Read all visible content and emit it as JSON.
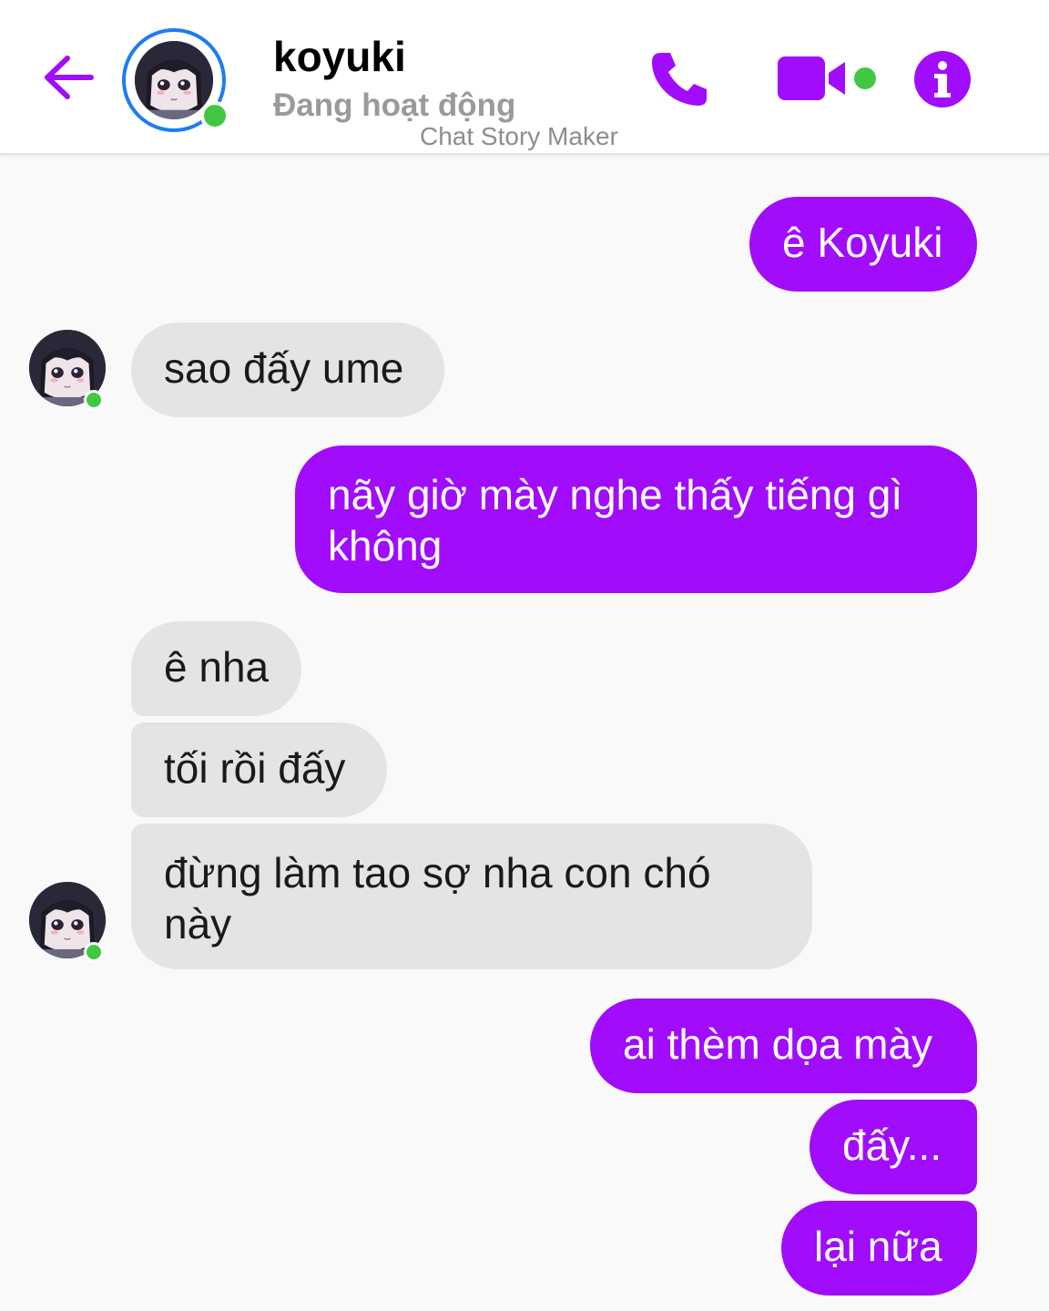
{
  "header": {
    "contact_name": "koyuki",
    "status": "Đang hoạt động",
    "watermark": "Chat Story Maker",
    "back_icon": "arrow-left-icon",
    "call_icon": "phone-icon",
    "video_icon": "video-camera-icon",
    "info_icon": "info-icon"
  },
  "colors": {
    "accent": "#a10cfb",
    "outgoing_bubble": "#a10cfb",
    "incoming_bubble": "#e4e4e4",
    "online": "#42c742",
    "avatar_ring": "#1e7cf2",
    "background": "#f9f9f9"
  },
  "messages": [
    {
      "from": "me",
      "text": "ê Koyuki"
    },
    {
      "from": "koyuki",
      "text": "sao đấy ume"
    },
    {
      "from": "me",
      "text": "nãy giờ mày nghe thấy tiếng gì không"
    },
    {
      "from": "koyuki",
      "text": "ê nha"
    },
    {
      "from": "koyuki",
      "text": "tối rồi đấy"
    },
    {
      "from": "koyuki",
      "text": "đừng làm tao sợ nha con chó này"
    },
    {
      "from": "me",
      "text": "ai thèm dọa mày"
    },
    {
      "from": "me",
      "text": "đấy..."
    },
    {
      "from": "me",
      "text": "lại nữa"
    }
  ]
}
